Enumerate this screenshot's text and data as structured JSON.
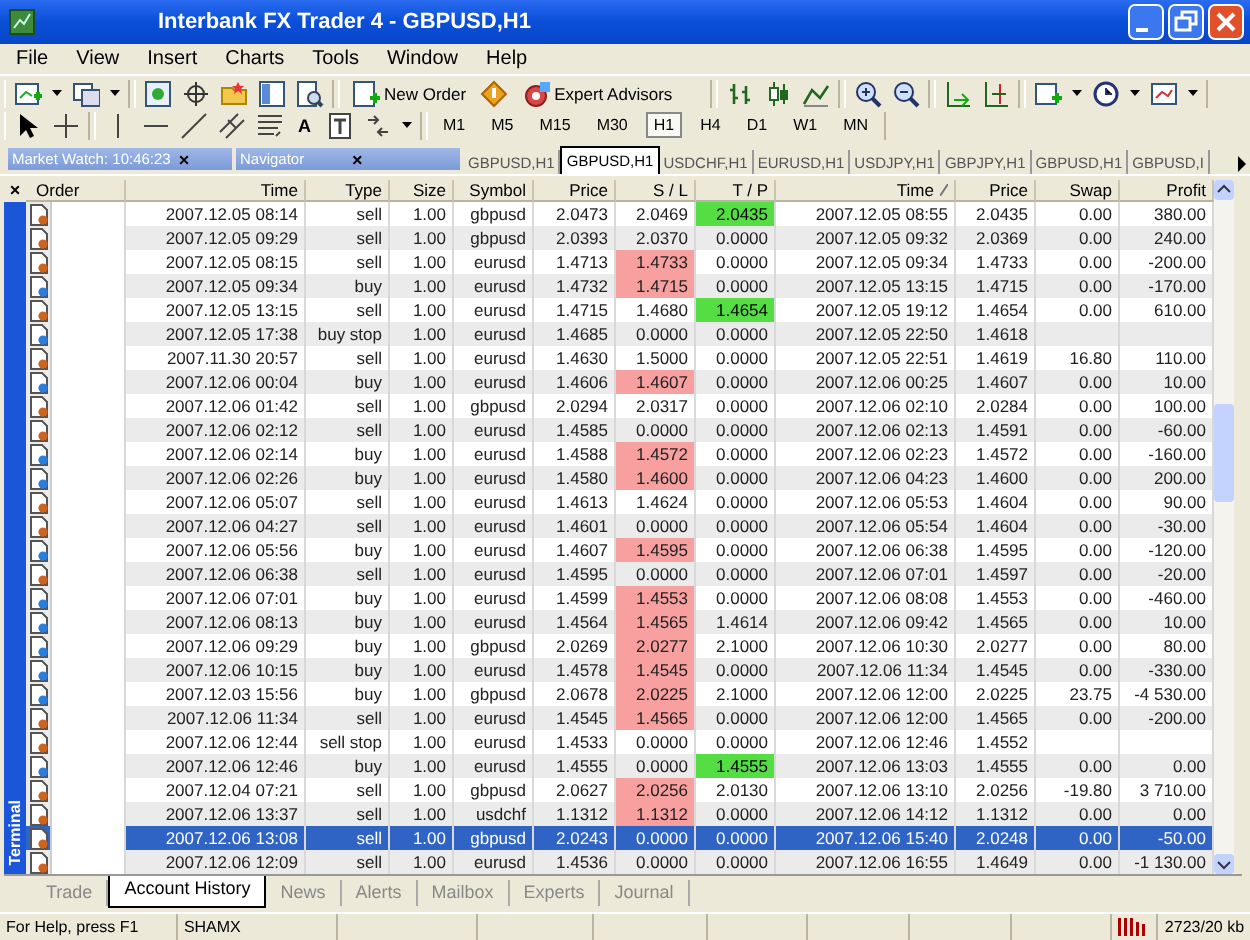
{
  "window": {
    "title": "Interbank FX Trader 4 - GBPUSD,H1"
  },
  "menu": [
    "File",
    "View",
    "Insert",
    "Charts",
    "Tools",
    "Window",
    "Help"
  ],
  "toolbar": {
    "new_order": "New Order",
    "expert_advisors": "Expert Advisors",
    "text_tool": "A"
  },
  "timeframes": [
    {
      "label": "M1",
      "selected": false
    },
    {
      "label": "M5",
      "selected": false
    },
    {
      "label": "M15",
      "selected": false
    },
    {
      "label": "M30",
      "selected": false
    },
    {
      "label": "H1",
      "selected": true
    },
    {
      "label": "H4",
      "selected": false
    },
    {
      "label": "D1",
      "selected": false
    },
    {
      "label": "W1",
      "selected": false
    },
    {
      "label": "MN",
      "selected": false
    }
  ],
  "panels": [
    {
      "title": "Market Watch: 10:46:23",
      "close": "×"
    },
    {
      "title": "Navigator",
      "close": "×"
    }
  ],
  "chart_tabs": [
    {
      "label": "GBPUSD,H1",
      "selected": false
    },
    {
      "label": "GBPUSD,H1",
      "selected": true
    },
    {
      "label": "USDCHF,H1",
      "selected": false
    },
    {
      "label": "EURUSD,H1",
      "selected": false
    },
    {
      "label": "USDJPY,H1",
      "selected": false
    },
    {
      "label": "GBPJPY,H1",
      "selected": false
    },
    {
      "label": "GBPUSD,H1",
      "selected": false
    },
    {
      "label": "GBPUSD,I",
      "selected": false
    }
  ],
  "terminal": {
    "close": "×",
    "label": "Terminal",
    "columns": [
      {
        "label": "Order",
        "sorted": false
      },
      {
        "label": "Time",
        "sorted": false
      },
      {
        "label": "Type",
        "sorted": false
      },
      {
        "label": "Size",
        "sorted": false
      },
      {
        "label": "Symbol",
        "sorted": false
      },
      {
        "label": "Price",
        "sorted": false
      },
      {
        "label": "S / L",
        "sorted": false
      },
      {
        "label": "T / P",
        "sorted": false
      },
      {
        "label": "Time",
        "sorted": true
      },
      {
        "label": "Price",
        "sorted": false
      },
      {
        "label": "Swap",
        "sorted": false
      },
      {
        "label": "Profit",
        "sorted": false
      }
    ],
    "rows": [
      {
        "kind": "sell",
        "time": "2007.12.05 08:14",
        "type": "sell",
        "size": "1.00",
        "symbol": "gbpusd",
        "price": "2.0473",
        "sl": "2.0469",
        "sl_hit": false,
        "tp": "2.0435",
        "tp_hit": true,
        "close_time": "2007.12.05 08:55",
        "close_price": "2.0435",
        "swap": "0.00",
        "profit": "380.00",
        "selected": false
      },
      {
        "kind": "sell",
        "time": "2007.12.05 09:29",
        "type": "sell",
        "size": "1.00",
        "symbol": "gbpusd",
        "price": "2.0393",
        "sl": "2.0370",
        "sl_hit": false,
        "tp": "0.0000",
        "tp_hit": false,
        "close_time": "2007.12.05 09:32",
        "close_price": "2.0369",
        "swap": "0.00",
        "profit": "240.00",
        "selected": false
      },
      {
        "kind": "sell",
        "time": "2007.12.05 08:15",
        "type": "sell",
        "size": "1.00",
        "symbol": "eurusd",
        "price": "1.4713",
        "sl": "1.4733",
        "sl_hit": true,
        "tp": "0.0000",
        "tp_hit": false,
        "close_time": "2007.12.05 09:34",
        "close_price": "1.4733",
        "swap": "0.00",
        "profit": "-200.00",
        "selected": false
      },
      {
        "kind": "buy",
        "time": "2007.12.05 09:34",
        "type": "buy",
        "size": "1.00",
        "symbol": "eurusd",
        "price": "1.4732",
        "sl": "1.4715",
        "sl_hit": true,
        "tp": "0.0000",
        "tp_hit": false,
        "close_time": "2007.12.05 13:15",
        "close_price": "1.4715",
        "swap": "0.00",
        "profit": "-170.00",
        "selected": false
      },
      {
        "kind": "sell",
        "time": "2007.12.05 13:15",
        "type": "sell",
        "size": "1.00",
        "symbol": "eurusd",
        "price": "1.4715",
        "sl": "1.4680",
        "sl_hit": false,
        "tp": "1.4654",
        "tp_hit": true,
        "close_time": "2007.12.05 19:12",
        "close_price": "1.4654",
        "swap": "0.00",
        "profit": "610.00",
        "selected": false
      },
      {
        "kind": "buy",
        "time": "2007.12.05 17:38",
        "type": "buy stop",
        "size": "1.00",
        "symbol": "eurusd",
        "price": "1.4685",
        "sl": "0.0000",
        "sl_hit": false,
        "tp": "0.0000",
        "tp_hit": false,
        "close_time": "2007.12.05 22:50",
        "close_price": "1.4618",
        "selected": false
      },
      {
        "kind": "sell",
        "time": "2007.11.30 20:57",
        "type": "sell",
        "size": "1.00",
        "symbol": "eurusd",
        "price": "1.4630",
        "sl": "1.5000",
        "sl_hit": false,
        "tp": "0.0000",
        "tp_hit": false,
        "close_time": "2007.12.05 22:51",
        "close_price": "1.4619",
        "swap": "16.80",
        "profit": "110.00",
        "selected": false
      },
      {
        "kind": "buy",
        "time": "2007.12.06 00:04",
        "type": "buy",
        "size": "1.00",
        "symbol": "eurusd",
        "price": "1.4606",
        "sl": "1.4607",
        "sl_hit": true,
        "tp": "0.0000",
        "tp_hit": false,
        "close_time": "2007.12.06 00:25",
        "close_price": "1.4607",
        "swap": "0.00",
        "profit": "10.00",
        "selected": false
      },
      {
        "kind": "sell",
        "time": "2007.12.06 01:42",
        "type": "sell",
        "size": "1.00",
        "symbol": "gbpusd",
        "price": "2.0294",
        "sl": "2.0317",
        "sl_hit": false,
        "tp": "0.0000",
        "tp_hit": false,
        "close_time": "2007.12.06 02:10",
        "close_price": "2.0284",
        "swap": "0.00",
        "profit": "100.00",
        "selected": false
      },
      {
        "kind": "sell",
        "time": "2007.12.06 02:12",
        "type": "sell",
        "size": "1.00",
        "symbol": "eurusd",
        "price": "1.4585",
        "sl": "0.0000",
        "sl_hit": false,
        "tp": "0.0000",
        "tp_hit": false,
        "close_time": "2007.12.06 02:13",
        "close_price": "1.4591",
        "swap": "0.00",
        "profit": "-60.00",
        "selected": false
      },
      {
        "kind": "buy",
        "time": "2007.12.06 02:14",
        "type": "buy",
        "size": "1.00",
        "symbol": "eurusd",
        "price": "1.4588",
        "sl": "1.4572",
        "sl_hit": true,
        "tp": "0.0000",
        "tp_hit": false,
        "close_time": "2007.12.06 02:23",
        "close_price": "1.4572",
        "swap": "0.00",
        "profit": "-160.00",
        "selected": false
      },
      {
        "kind": "buy",
        "time": "2007.12.06 02:26",
        "type": "buy",
        "size": "1.00",
        "symbol": "eurusd",
        "price": "1.4580",
        "sl": "1.4600",
        "sl_hit": true,
        "tp": "0.0000",
        "tp_hit": false,
        "close_time": "2007.12.06 04:23",
        "close_price": "1.4600",
        "swap": "0.00",
        "profit": "200.00",
        "selected": false
      },
      {
        "kind": "sell",
        "time": "2007.12.06 05:07",
        "type": "sell",
        "size": "1.00",
        "symbol": "eurusd",
        "price": "1.4613",
        "sl": "1.4624",
        "sl_hit": false,
        "tp": "0.0000",
        "tp_hit": false,
        "close_time": "2007.12.06 05:53",
        "close_price": "1.4604",
        "swap": "0.00",
        "profit": "90.00",
        "selected": false
      },
      {
        "kind": "sell",
        "time": "2007.12.06 04:27",
        "type": "sell",
        "size": "1.00",
        "symbol": "eurusd",
        "price": "1.4601",
        "sl": "0.0000",
        "sl_hit": false,
        "tp": "0.0000",
        "tp_hit": false,
        "close_time": "2007.12.06 05:54",
        "close_price": "1.4604",
        "swap": "0.00",
        "profit": "-30.00",
        "selected": false
      },
      {
        "kind": "buy",
        "time": "2007.12.06 05:56",
        "type": "buy",
        "size": "1.00",
        "symbol": "eurusd",
        "price": "1.4607",
        "sl": "1.4595",
        "sl_hit": true,
        "tp": "0.0000",
        "tp_hit": false,
        "close_time": "2007.12.06 06:38",
        "close_price": "1.4595",
        "swap": "0.00",
        "profit": "-120.00",
        "selected": false
      },
      {
        "kind": "sell",
        "time": "2007.12.06 06:38",
        "type": "sell",
        "size": "1.00",
        "symbol": "eurusd",
        "price": "1.4595",
        "sl": "0.0000",
        "sl_hit": false,
        "tp": "0.0000",
        "tp_hit": false,
        "close_time": "2007.12.06 07:01",
        "close_price": "1.4597",
        "swap": "0.00",
        "profit": "-20.00",
        "selected": false
      },
      {
        "kind": "buy",
        "time": "2007.12.06 07:01",
        "type": "buy",
        "size": "1.00",
        "symbol": "eurusd",
        "price": "1.4599",
        "sl": "1.4553",
        "sl_hit": true,
        "tp": "0.0000",
        "tp_hit": false,
        "close_time": "2007.12.06 08:08",
        "close_price": "1.4553",
        "swap": "0.00",
        "profit": "-460.00",
        "selected": false
      },
      {
        "kind": "buy",
        "time": "2007.12.06 08:13",
        "type": "buy",
        "size": "1.00",
        "symbol": "eurusd",
        "price": "1.4564",
        "sl": "1.4565",
        "sl_hit": true,
        "tp": "1.4614",
        "tp_hit": false,
        "close_time": "2007.12.06 09:42",
        "close_price": "1.4565",
        "swap": "0.00",
        "profit": "10.00",
        "selected": false
      },
      {
        "kind": "buy",
        "time": "2007.12.06 09:29",
        "type": "buy",
        "size": "1.00",
        "symbol": "gbpusd",
        "price": "2.0269",
        "sl": "2.0277",
        "sl_hit": true,
        "tp": "2.1000",
        "tp_hit": false,
        "close_time": "2007.12.06 10:30",
        "close_price": "2.0277",
        "swap": "0.00",
        "profit": "80.00",
        "selected": false
      },
      {
        "kind": "buy",
        "time": "2007.12.06 10:15",
        "type": "buy",
        "size": "1.00",
        "symbol": "eurusd",
        "price": "1.4578",
        "sl": "1.4545",
        "sl_hit": true,
        "tp": "0.0000",
        "tp_hit": false,
        "close_time": "2007.12.06 11:34",
        "close_price": "1.4545",
        "swap": "0.00",
        "profit": "-330.00",
        "selected": false
      },
      {
        "kind": "buy",
        "time": "2007.12.03 15:56",
        "type": "buy",
        "size": "1.00",
        "symbol": "gbpusd",
        "price": "2.0678",
        "sl": "2.0225",
        "sl_hit": true,
        "tp": "2.1000",
        "tp_hit": false,
        "close_time": "2007.12.06 12:00",
        "close_price": "2.0225",
        "swap": "23.75",
        "profit": "-4 530.00",
        "selected": false
      },
      {
        "kind": "sell",
        "time": "2007.12.06 11:34",
        "type": "sell",
        "size": "1.00",
        "symbol": "eurusd",
        "price": "1.4545",
        "sl": "1.4565",
        "sl_hit": true,
        "tp": "0.0000",
        "tp_hit": false,
        "close_time": "2007.12.06 12:00",
        "close_price": "1.4565",
        "swap": "0.00",
        "profit": "-200.00",
        "selected": false
      },
      {
        "kind": "sell",
        "time": "2007.12.06 12:44",
        "type": "sell stop",
        "size": "1.00",
        "symbol": "eurusd",
        "price": "1.4533",
        "sl": "0.0000",
        "sl_hit": false,
        "tp": "0.0000",
        "tp_hit": false,
        "close_time": "2007.12.06 12:46",
        "close_price": "1.4552",
        "selected": false
      },
      {
        "kind": "buy",
        "time": "2007.12.06 12:46",
        "type": "buy",
        "size": "1.00",
        "symbol": "eurusd",
        "price": "1.4555",
        "sl": "0.0000",
        "sl_hit": false,
        "tp": "1.4555",
        "tp_hit": true,
        "close_time": "2007.12.06 13:03",
        "close_price": "1.4555",
        "swap": "0.00",
        "profit": "0.00",
        "selected": false
      },
      {
        "kind": "sell",
        "time": "2007.12.04 07:21",
        "type": "sell",
        "size": "1.00",
        "symbol": "gbpusd",
        "price": "2.0627",
        "sl": "2.0256",
        "sl_hit": true,
        "tp": "2.0130",
        "tp_hit": false,
        "close_time": "2007.12.06 13:10",
        "close_price": "2.0256",
        "swap": "-19.80",
        "profit": "3 710.00",
        "selected": false
      },
      {
        "kind": "sell",
        "time": "2007.12.06 13:37",
        "type": "sell",
        "size": "1.00",
        "symbol": "usdchf",
        "price": "1.1312",
        "sl": "1.1312",
        "sl_hit": true,
        "tp": "0.0000",
        "tp_hit": false,
        "close_time": "2007.12.06 14:12",
        "close_price": "1.1312",
        "swap": "0.00",
        "profit": "0.00",
        "selected": false
      },
      {
        "kind": "sell",
        "time": "2007.12.06 13:08",
        "type": "sell",
        "size": "1.00",
        "symbol": "gbpusd",
        "price": "2.0243",
        "sl": "0.0000",
        "sl_hit": false,
        "tp": "0.0000",
        "tp_hit": false,
        "close_time": "2007.12.06 15:40",
        "close_price": "2.0248",
        "swap": "0.00",
        "profit": "-50.00",
        "selected": true
      },
      {
        "kind": "sell",
        "time": "2007.12.06 12:09",
        "type": "sell",
        "size": "1.00",
        "symbol": "eurusd",
        "price": "1.4536",
        "sl": "0.0000",
        "sl_hit": false,
        "tp": "0.0000",
        "tp_hit": false,
        "close_time": "2007.12.06 16:55",
        "close_price": "1.4649",
        "swap": "0.00",
        "profit": "-1 130.00",
        "selected": false
      }
    ],
    "tabs": [
      {
        "label": "Trade",
        "selected": false
      },
      {
        "label": "Account History",
        "selected": true
      },
      {
        "label": "News",
        "selected": false
      },
      {
        "label": "Alerts",
        "selected": false
      },
      {
        "label": "Mailbox",
        "selected": false
      },
      {
        "label": "Experts",
        "selected": false
      },
      {
        "label": "Journal",
        "selected": false
      }
    ]
  },
  "status_bar": {
    "help": "For Help, press F1",
    "profile": "SHAMX",
    "traffic": "2723/20 kb"
  }
}
